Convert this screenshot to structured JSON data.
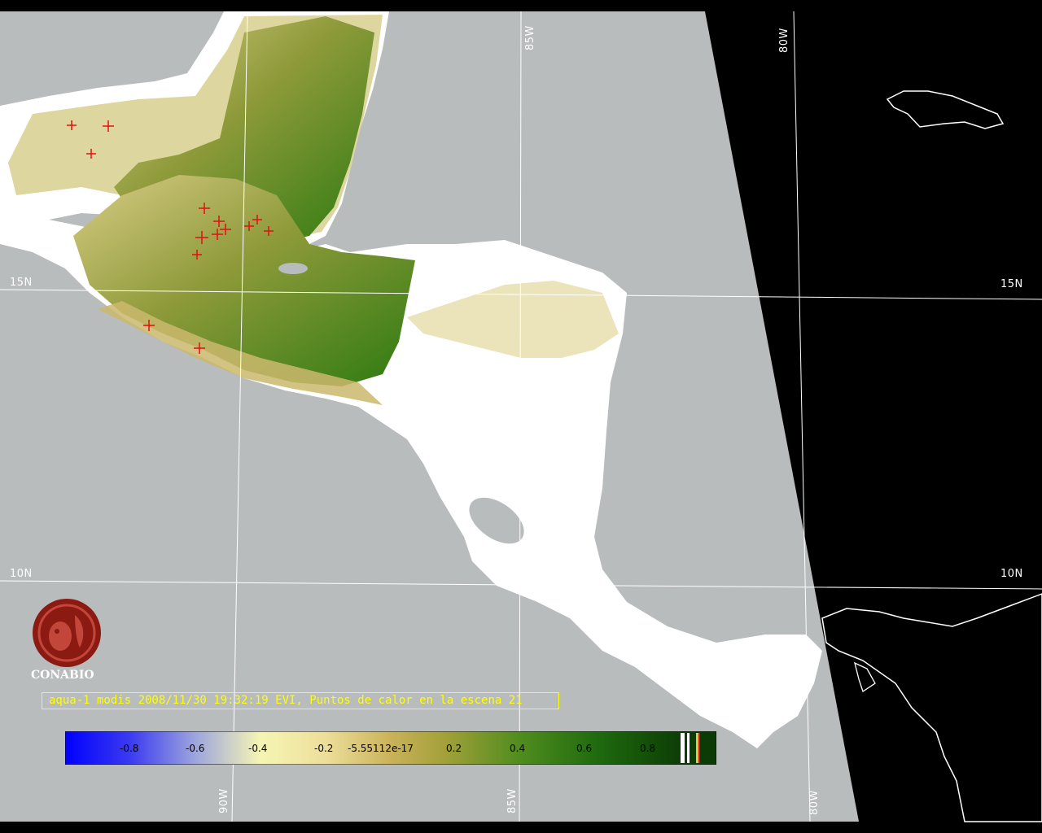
{
  "map": {
    "grid_labels": {
      "lat": [
        "15N",
        "10N"
      ],
      "lon": [
        "90W",
        "85W",
        "80W"
      ]
    },
    "colors": {
      "ocean": "#b9bcbd",
      "no_data": "#000000",
      "cloud": "#ffffff",
      "vegetation_high": "#2f7d12",
      "vegetation_low": "#d7c879",
      "hotspot": "#e01010",
      "grid": "#ffffff",
      "caption": "#ffff00"
    }
  },
  "logo": {
    "name": "CONABIO"
  },
  "caption": {
    "text": "aqua-1 modis 2008/11/30 19:32:19 EVI, Puntos de calor en la escena 21"
  },
  "colorbar": {
    "ticks": [
      "-0.8",
      "-0.6",
      "-0.4",
      "-0.2",
      "-5.55112e-17",
      "0.2",
      "0.4",
      "0.6",
      "0.8"
    ]
  }
}
